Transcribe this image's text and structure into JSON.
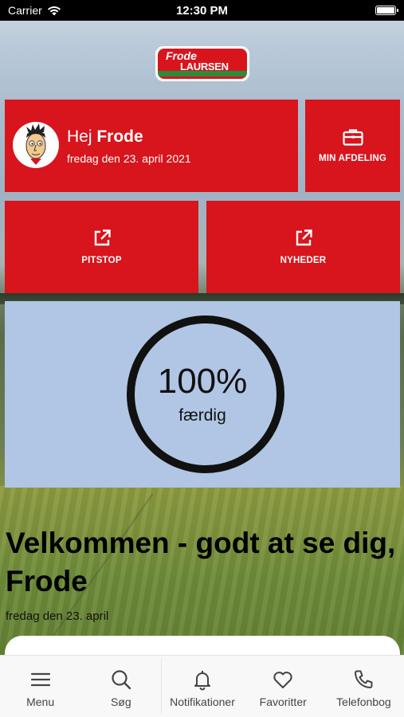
{
  "status_bar": {
    "carrier": "Carrier",
    "time": "12:30 PM"
  },
  "logo": {
    "line1": "Frode",
    "line2": "LAURSEN",
    "colors": {
      "red": "#d8151d",
      "green": "#2b8b3a"
    }
  },
  "greeting": {
    "hello": "Hej",
    "name": "Frode",
    "date": "fredag den 23. april 2021"
  },
  "tiles": {
    "afdeling": {
      "label": "MIN AFDELING",
      "icon": "briefcase-icon"
    },
    "pitstop": {
      "label": "PITSTOP",
      "icon": "external-link-icon"
    },
    "nyheder": {
      "label": "NYHEDER",
      "icon": "external-link-icon"
    }
  },
  "progress": {
    "value": 100,
    "value_text": "100%",
    "label": "færdig"
  },
  "welcome": {
    "title": "Velkommen - godt at se dig, Frode",
    "date": "fredag den 23. april"
  },
  "tab_bar": {
    "items": [
      {
        "label": "Menu",
        "icon": "hamburger-menu-icon"
      },
      {
        "label": "Søg",
        "icon": "search-icon"
      },
      {
        "label": "Notifikationer",
        "icon": "bell-icon"
      },
      {
        "label": "Favoritter",
        "icon": "heart-icon"
      },
      {
        "label": "Telefonbog",
        "icon": "phone-icon"
      }
    ]
  },
  "colors": {
    "tile_red": "#d8141c",
    "progress_panel": "#b1c6e4",
    "tab_bar": "#f8f8f8"
  }
}
